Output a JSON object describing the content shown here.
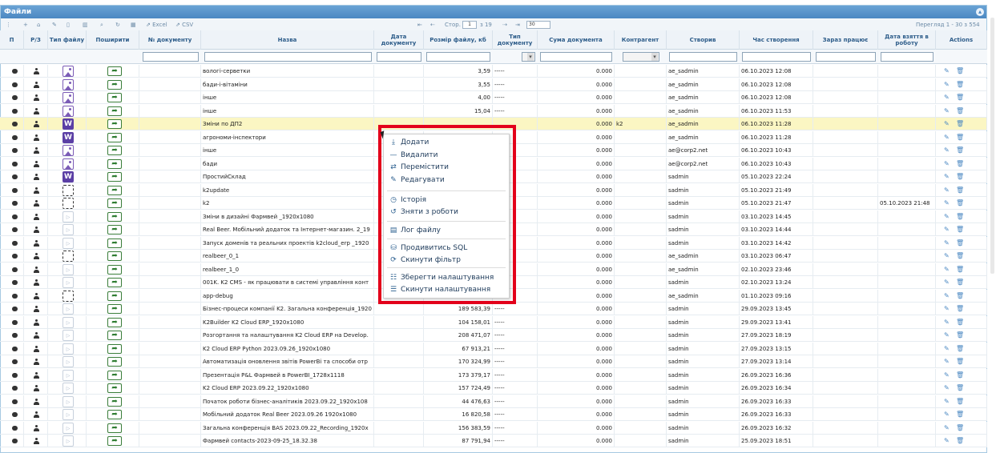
{
  "panel": {
    "title": "Файли"
  },
  "toolbar": {
    "excel_label": "Excel",
    "csv_label": "CSV",
    "page_prefix": "Стор.",
    "page_value": "1",
    "page_suffix": "з 19",
    "per_page": "30",
    "view_info": "Перегляд 1 - 30 з 554"
  },
  "columns": {
    "view": "П",
    "rz": "Р/З",
    "type": "Тип файлу",
    "share": "Поширити",
    "docno": "№ документу",
    "name": "Назва",
    "docdate": "Дата документу",
    "size": "Розмір файлу, кб",
    "doctype": "Тип документу",
    "sum": "Сума документа",
    "contractor": "Контрагент",
    "creator": "Створив",
    "created": "Час створення",
    "worknow": "Зараз працює",
    "taken": "Дата взяття в роботу",
    "actions": "Actions"
  },
  "rows": [
    {
      "type": "img",
      "name": "вологі-серветки",
      "size": "3,59",
      "dt": "-----",
      "sum": "0.000",
      "contr": "",
      "creator": "ae_sadmin",
      "created": "06.10.2023 12:08",
      "taken": ""
    },
    {
      "type": "img",
      "name": "бади-і-вітаміни",
      "size": "3,55",
      "dt": "-----",
      "sum": "0.000",
      "contr": "",
      "creator": "ae_sadmin",
      "created": "06.10.2023 12:08",
      "taken": ""
    },
    {
      "type": "img",
      "name": "інше",
      "size": "4,00",
      "dt": "-----",
      "sum": "0.000",
      "contr": "",
      "creator": "ae_sadmin",
      "created": "06.10.2023 12:08",
      "taken": ""
    },
    {
      "type": "img",
      "name": "інше",
      "size": "15,04",
      "dt": "-----",
      "sum": "0.000",
      "contr": "",
      "creator": "ae_sadmin",
      "created": "06.10.2023 11:53",
      "taken": ""
    },
    {
      "type": "word",
      "name": "Зміни по ДП2",
      "size": "",
      "dt": "",
      "sum": "0.000",
      "contr": "k2",
      "creator": "ae_sadmin",
      "created": "06.10.2023 11:28",
      "taken": "",
      "hl": true
    },
    {
      "type": "word",
      "name": "агрономи-інспектори",
      "size": "",
      "dt": "",
      "sum": "0.000",
      "contr": "",
      "creator": "ae_sadmin",
      "created": "06.10.2023 11:28",
      "taken": ""
    },
    {
      "type": "img",
      "name": "інше",
      "size": "",
      "dt": "",
      "sum": "0.000",
      "contr": "",
      "creator": "ae@corp2.net",
      "created": "06.10.2023 10:43",
      "taken": ""
    },
    {
      "type": "img",
      "name": "бади",
      "size": "",
      "dt": "",
      "sum": "0.000",
      "contr": "",
      "creator": "ae@corp2.net",
      "created": "06.10.2023 10:43",
      "taken": ""
    },
    {
      "type": "word",
      "name": "ПростийСклад",
      "size": "",
      "dt": "",
      "sum": "0.000",
      "contr": "",
      "creator": "sadmin",
      "created": "05.10.2023 22:24",
      "taken": ""
    },
    {
      "type": "blank",
      "name": "k2update",
      "size": "",
      "dt": "",
      "sum": "0.000",
      "contr": "",
      "creator": "sadmin",
      "created": "05.10.2023 21:49",
      "taken": ""
    },
    {
      "type": "blank",
      "name": "k2",
      "size": "",
      "dt": "",
      "sum": "0.000",
      "contr": "",
      "creator": "sadmin",
      "created": "05.10.2023 21:47",
      "taken": "05.10.2023 21:48"
    },
    {
      "type": "vid",
      "name": "Зміни в дизайні Фармвей _1920x1080",
      "size": "",
      "dt": "",
      "sum": "0.000",
      "contr": "",
      "creator": "sadmin",
      "created": "03.10.2023 14:45",
      "taken": ""
    },
    {
      "type": "vid",
      "name": "Real Beer. Мобільний додаток та Інтернет-магазин. 2_19",
      "size": "",
      "dt": "",
      "sum": "0.000",
      "contr": "",
      "creator": "sadmin",
      "created": "03.10.2023 14:44",
      "taken": ""
    },
    {
      "type": "vid",
      "name": "Запуск доменів та реальних проектів k2cloud_erp _1920",
      "size": "",
      "dt": "",
      "sum": "0.000",
      "contr": "",
      "creator": "sadmin",
      "created": "03.10.2023 14:42",
      "taken": ""
    },
    {
      "type": "blank",
      "name": "realbeer_0_1",
      "size": "",
      "dt": "",
      "sum": "0.000",
      "contr": "",
      "creator": "ae_sadmin",
      "created": "03.10.2023 06:47",
      "taken": ""
    },
    {
      "type": "vid",
      "name": "realbeer_1_0",
      "size": "",
      "dt": "",
      "sum": "0.000",
      "contr": "",
      "creator": "ae_sadmin",
      "created": "02.10.2023 23:46",
      "taken": ""
    },
    {
      "type": "vid",
      "name": "001K. K2 CMS - як працювати в системі управління конт",
      "size": "",
      "dt": "",
      "sum": "0.000",
      "contr": "",
      "creator": "sadmin",
      "created": "02.10.2023 13:24",
      "taken": ""
    },
    {
      "type": "blank",
      "name": "app-debug",
      "size": "",
      "dt": "",
      "sum": "0.000",
      "contr": "",
      "creator": "ae_sadmin",
      "created": "01.10.2023 09:16",
      "taken": ""
    },
    {
      "type": "vid",
      "name": "Бізнес-процеси компанії K2. Загальна конференція_1920",
      "size": "189 583,39",
      "dt": "-----",
      "sum": "0.000",
      "contr": "",
      "creator": "sadmin",
      "created": "29.09.2023 13:45",
      "taken": ""
    },
    {
      "type": "vid",
      "name": "K2Builder K2 Cloud ERP_1920x1080",
      "size": "104 158,01",
      "dt": "-----",
      "sum": "0.000",
      "contr": "",
      "creator": "sadmin",
      "created": "29.09.2023 13:41",
      "taken": ""
    },
    {
      "type": "vid",
      "name": "Розгортання та налаштування K2 Cloud ERP на Develop.",
      "size": "208 471,07",
      "dt": "-----",
      "sum": "0.000",
      "contr": "",
      "creator": "sadmin",
      "created": "27.09.2023 18:19",
      "taken": ""
    },
    {
      "type": "vid",
      "name": "K2 Cloud ERP Python 2023.09.26_1920x1080",
      "size": "67 913,21",
      "dt": "-----",
      "sum": "0.000",
      "contr": "",
      "creator": "sadmin",
      "created": "27.09.2023 13:15",
      "taken": ""
    },
    {
      "type": "vid",
      "name": "Автоматизація оновлення звітів PowerBi та способи отр",
      "size": "170 324,99",
      "dt": "-----",
      "sum": "0.000",
      "contr": "",
      "creator": "sadmin",
      "created": "27.09.2023 13:14",
      "taken": ""
    },
    {
      "type": "vid",
      "name": "Презентація P&L Фармвей в PowerBI_1728x1118",
      "size": "173 379,17",
      "dt": "-----",
      "sum": "0.000",
      "contr": "",
      "creator": "sadmin",
      "created": "26.09.2023 16:36",
      "taken": ""
    },
    {
      "type": "vid",
      "name": "K2 Cloud ERP 2023.09.22_1920x1080",
      "size": "157 724,49",
      "dt": "-----",
      "sum": "0.000",
      "contr": "",
      "creator": "sadmin",
      "created": "26.09.2023 16:34",
      "taken": ""
    },
    {
      "type": "vid",
      "name": "Початок роботи бізнес-аналітиків 2023.09.22_1920x108",
      "size": "44 476,63",
      "dt": "-----",
      "sum": "0.000",
      "contr": "",
      "creator": "sadmin",
      "created": "26.09.2023 16:33",
      "taken": ""
    },
    {
      "type": "vid",
      "name": "Мобільний додаток Real Beer 2023.09.26 1920x1080",
      "size": "16 820,58",
      "dt": "-----",
      "sum": "0.000",
      "contr": "",
      "creator": "sadmin",
      "created": "26.09.2023 16:33",
      "taken": ""
    },
    {
      "type": "vid",
      "name": "Загальна конференція BAS 2023.09.22_Recording_1920x",
      "size": "156 383,59",
      "dt": "-----",
      "sum": "0.000",
      "contr": "",
      "creator": "sadmin",
      "created": "26.09.2023 16:32",
      "taken": ""
    },
    {
      "type": "vid",
      "name": "Фармвей contacts-2023-09-25_18.32.38",
      "size": "87 791,94",
      "dt": "-----",
      "sum": "0.000",
      "contr": "",
      "creator": "sadmin",
      "created": "25.09.2023 18:51",
      "taken": ""
    }
  ],
  "context_menu": {
    "items": [
      {
        "icon": "download-icon",
        "glyph": "⤓",
        "label": "Додати"
      },
      {
        "icon": "minus-icon",
        "glyph": "—",
        "label": "Видалити"
      },
      {
        "icon": "move-icon",
        "glyph": "⇄",
        "label": "Перемістити"
      },
      {
        "icon": "edit-icon",
        "glyph": "✎",
        "label": "Редагувати"
      },
      {
        "icon": "history-icon",
        "glyph": "◷",
        "label": "Історія"
      },
      {
        "icon": "undo-icon",
        "glyph": "↺",
        "label": "Зняти з роботи"
      },
      {
        "icon": "book-icon",
        "glyph": "▤",
        "label": "Лог файлу"
      },
      {
        "icon": "database-icon",
        "glyph": "⛁",
        "label": "Продивитись SQL"
      },
      {
        "icon": "refresh-icon",
        "glyph": "⟳",
        "label": "Скинути фільтр"
      },
      {
        "icon": "sliders-icon",
        "glyph": "☷",
        "label": "Зберегти налаштування"
      },
      {
        "icon": "list-icon",
        "glyph": "☰",
        "label": "Скинути налаштування"
      }
    ]
  }
}
